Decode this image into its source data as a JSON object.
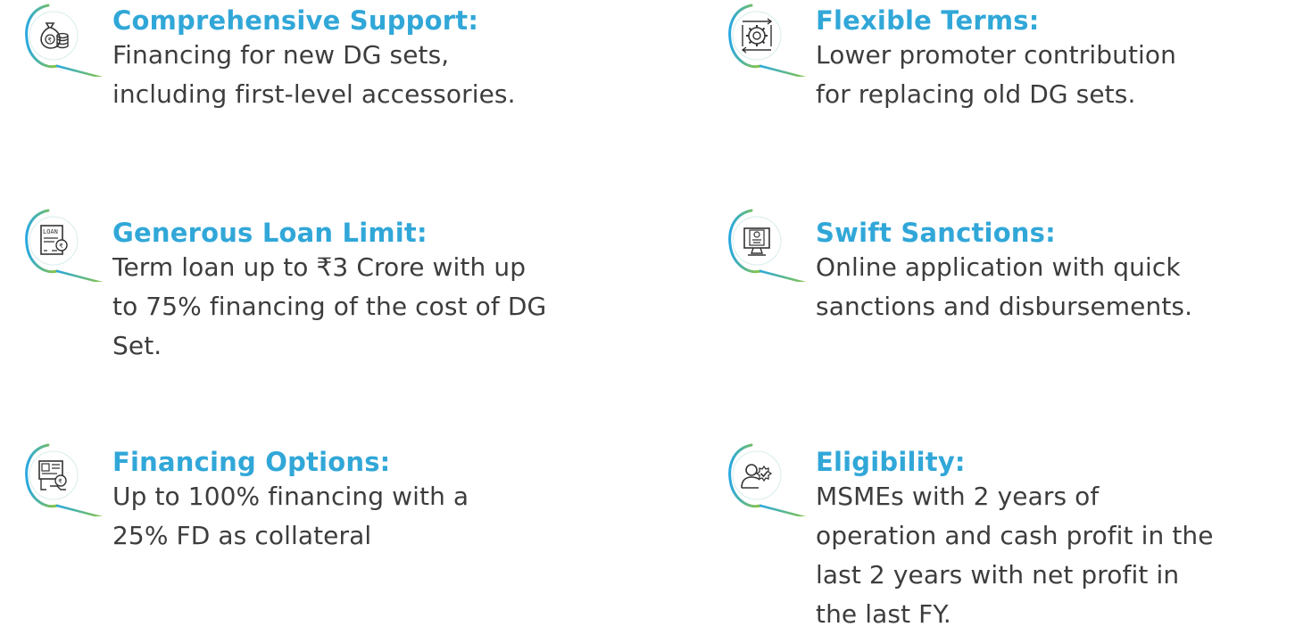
{
  "colors": {
    "title": "#31a7d8",
    "body_text": "#3d3d3d",
    "icon_ring_start": "#29a8e0",
    "icon_ring_end": "#8cc63f",
    "icon_stroke": "#333333"
  },
  "features": [
    {
      "icon": "money-bag-coins-icon",
      "title": "Comprehensive Support:",
      "lines": [
        "Financing for new DG sets,",
        "including first-level accessories."
      ]
    },
    {
      "icon": "gear-arrows-icon",
      "title": "Flexible Terms:",
      "lines": [
        "Lower promoter contribution",
        "for replacing old DG sets."
      ]
    },
    {
      "icon": "loan-document-icon",
      "title": "Generous Loan Limit:",
      "lines": [
        "Term loan up to ₹3 Crore with up",
        "to 75% financing of the cost of DG",
        "Set."
      ]
    },
    {
      "icon": "online-monitor-icon",
      "title": "Swift Sanctions:",
      "lines": [
        "Online application with quick",
        "sanctions and disbursements."
      ]
    },
    {
      "icon": "financing-options-icon",
      "title": "Financing Options:",
      "lines": [
        "Up to 100% financing with a",
        "25% FD as collateral"
      ]
    },
    {
      "icon": "eligibility-check-icon",
      "title": "Eligibility:",
      "lines": [
        "MSMEs with 2 years of",
        "operation and cash profit in the",
        "last 2 years with net profit in",
        "the last FY."
      ]
    }
  ]
}
